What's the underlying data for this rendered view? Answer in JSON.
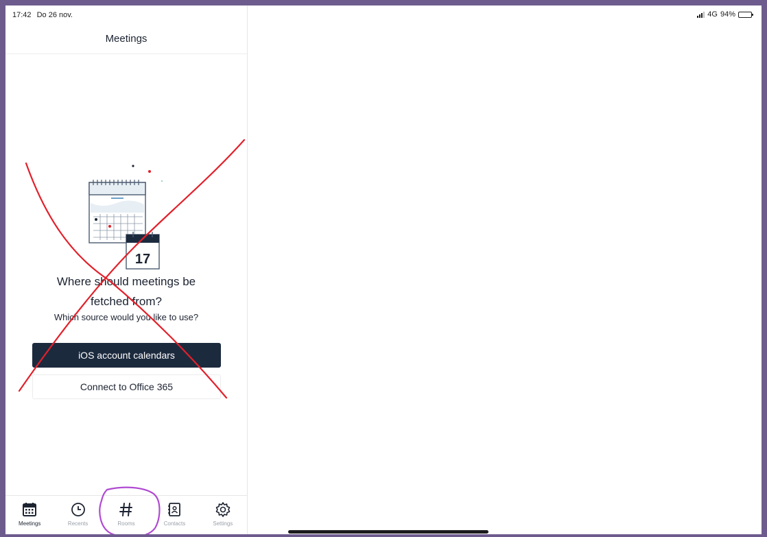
{
  "status_bar": {
    "time": "17:42",
    "date": "Do 26 nov.",
    "network": "4G",
    "battery": "94%",
    "battery_level": 0.94
  },
  "nav": {
    "title": "Meetings"
  },
  "empty_state": {
    "calendar_day": "17",
    "heading_line1": "Where should meetings be",
    "heading_line2": "fetched from?",
    "subheading": "Which source would you like to use?"
  },
  "buttons": {
    "primary_label": "iOS account calendars",
    "secondary_label": "Connect to Office 365"
  },
  "tabs": [
    {
      "label": "Meetings",
      "icon": "calendar-icon",
      "active": true
    },
    {
      "label": "Recents",
      "icon": "clock-icon",
      "active": false
    },
    {
      "label": "Rooms",
      "icon": "hash-icon",
      "active": false
    },
    {
      "label": "Contacts",
      "icon": "contacts-book-icon",
      "active": false
    },
    {
      "label": "Settings",
      "icon": "gear-icon",
      "active": false
    }
  ],
  "colors": {
    "primary_button": "#1c2a3e",
    "annotation_cross": "#e2202a",
    "annotation_circle": "#b04ad2",
    "frame": "#6e5b8e"
  }
}
